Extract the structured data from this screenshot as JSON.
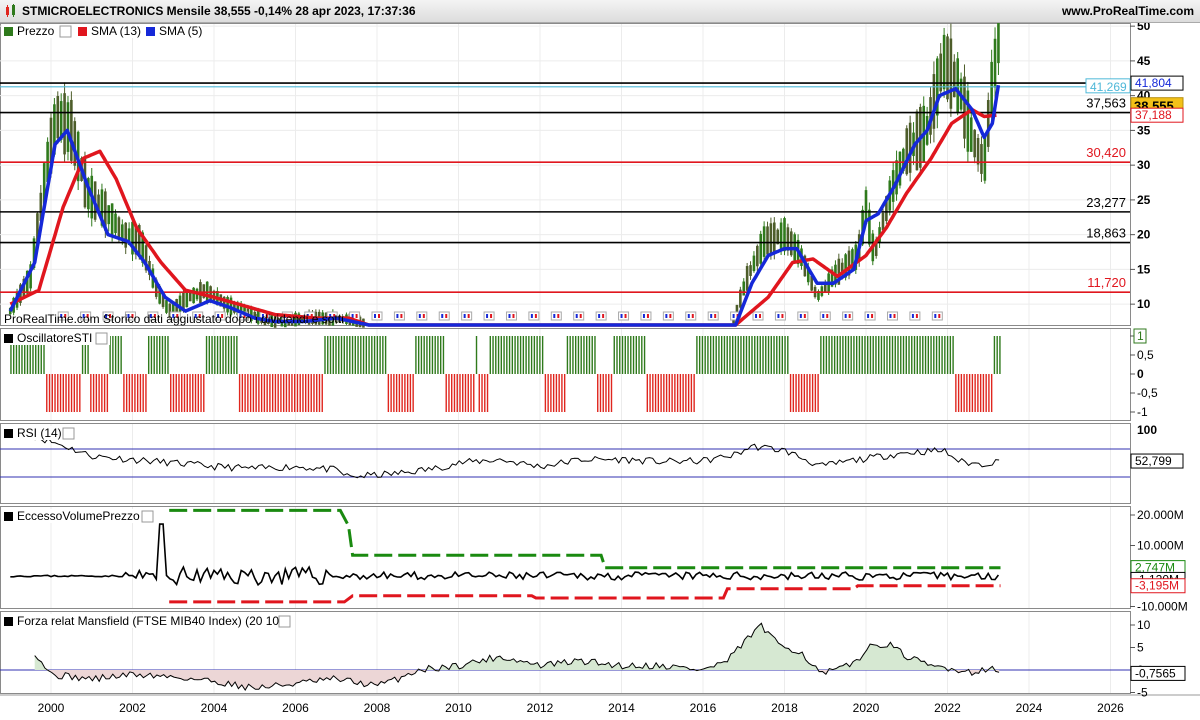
{
  "header": {
    "title": "STMICROELECTRONICS Mensile 38,555 -0,14% 28 apr 2023, 17:37:36",
    "site": "www.ProRealTime.com"
  },
  "watermark": "ProRealTime.com  Storico dati aggiustato dopo i dividendi e sotti",
  "colors": {
    "up": "#2f7a1c",
    "down": "#e0261e",
    "sma13": "#e0161e",
    "sma5": "#1528d8",
    "cyan": "#4fb8d8",
    "vol_upper": "#1a8a10",
    "vol_lower": "#e0161e"
  },
  "chart_data": [
    {
      "panel": "price",
      "type": "bar",
      "legend": [
        {
          "label": "Prezzo",
          "icon": "price-icon"
        },
        {
          "label": "SMA (13)",
          "color": "#e0161e"
        },
        {
          "label": "SMA (5)",
          "color": "#1528d8"
        }
      ],
      "x_ticks": [
        "2000",
        "2002",
        "2004",
        "2006",
        "2008",
        "2010",
        "2012",
        "2014",
        "2016",
        "2018",
        "2020",
        "2022",
        "2024",
        "2026"
      ],
      "y_ticks": [
        "50",
        "45",
        "40",
        "35",
        "30",
        "25",
        "20",
        "15",
        "10"
      ],
      "ylim": [
        7,
        50
      ],
      "levels": [
        {
          "value": 41.804,
          "label": "41,804",
          "color": "#000000",
          "tag": "box"
        },
        {
          "value": 41.269,
          "label": "41,269",
          "color": "#4fb8d8",
          "tag": "box"
        },
        {
          "value": 37.563,
          "label": "37,563",
          "color": "#000000",
          "tag": "text"
        },
        {
          "value": 30.42,
          "label": "30,420",
          "color": "#e0161e",
          "tag": "text"
        },
        {
          "value": 23.277,
          "label": "23,277",
          "color": "#000000",
          "tag": "text"
        },
        {
          "value": 18.863,
          "label": "18,863",
          "color": "#000000",
          "tag": "text"
        },
        {
          "value": 11.72,
          "label": "11,720",
          "color": "#e0161e",
          "tag": "text"
        }
      ],
      "last_price": {
        "value": 38.555,
        "label": "38,555"
      },
      "sma13_last": {
        "value": 37.188,
        "label": "37,188"
      },
      "sma5_anchors": [
        [
          1999.0,
          9
        ],
        [
          1999.6,
          16
        ],
        [
          2000.1,
          33
        ],
        [
          2000.4,
          35
        ],
        [
          2000.9,
          27
        ],
        [
          2001.4,
          20
        ],
        [
          2001.9,
          19
        ],
        [
          2002.3,
          16
        ],
        [
          2002.8,
          11
        ],
        [
          2003.3,
          9
        ],
        [
          2003.9,
          10.5
        ],
        [
          2004.4,
          9.5
        ],
        [
          2005.0,
          8
        ],
        [
          2005.5,
          7.5
        ],
        [
          2006.2,
          7.5
        ],
        [
          2007.0,
          8
        ],
        [
          2007.8,
          7
        ],
        [
          2016.8,
          7
        ],
        [
          2017.2,
          13
        ],
        [
          2017.6,
          17
        ],
        [
          2018.0,
          18
        ],
        [
          2018.3,
          18
        ],
        [
          2018.8,
          13
        ],
        [
          2019.2,
          13
        ],
        [
          2019.7,
          15
        ],
        [
          2020.0,
          22
        ],
        [
          2020.3,
          23
        ],
        [
          2020.7,
          27
        ],
        [
          2021.2,
          33
        ],
        [
          2021.5,
          35
        ],
        [
          2021.8,
          40
        ],
        [
          2022.2,
          41
        ],
        [
          2022.6,
          38
        ],
        [
          2022.9,
          34
        ],
        [
          2023.1,
          36
        ],
        [
          2023.25,
          41.5
        ]
      ],
      "sma13_anchors": [
        [
          1999.0,
          10
        ],
        [
          1999.7,
          12
        ],
        [
          2000.3,
          24
        ],
        [
          2000.8,
          31
        ],
        [
          2001.2,
          32
        ],
        [
          2001.6,
          28
        ],
        [
          2002.1,
          21
        ],
        [
          2002.7,
          16
        ],
        [
          2003.3,
          12
        ],
        [
          2004.0,
          11
        ],
        [
          2004.6,
          10
        ],
        [
          2005.5,
          8.5
        ],
        [
          2006.5,
          8
        ],
        [
          2007.3,
          8
        ],
        [
          2007.8,
          7
        ],
        [
          2016.8,
          7
        ],
        [
          2017.6,
          11
        ],
        [
          2018.2,
          16
        ],
        [
          2018.7,
          16.5
        ],
        [
          2019.3,
          14
        ],
        [
          2020.0,
          17
        ],
        [
          2020.5,
          21
        ],
        [
          2021.0,
          26
        ],
        [
          2021.6,
          31
        ],
        [
          2022.1,
          36
        ],
        [
          2022.6,
          38
        ],
        [
          2022.9,
          37
        ],
        [
          2023.2,
          37.188
        ]
      ],
      "price_anchors": [
        [
          1999.0,
          9
        ],
        [
          1999.5,
          14
        ],
        [
          1999.9,
          30
        ],
        [
          2000.15,
          37
        ],
        [
          2000.5,
          35
        ],
        [
          2000.9,
          26
        ],
        [
          2001.4,
          23
        ],
        [
          2001.8,
          20
        ],
        [
          2002.2,
          19
        ],
        [
          2002.6,
          12
        ],
        [
          2002.9,
          9
        ],
        [
          2003.4,
          11
        ],
        [
          2003.8,
          12
        ],
        [
          2004.3,
          10
        ],
        [
          2004.9,
          8.5
        ],
        [
          2005.5,
          7.5
        ],
        [
          2006.4,
          8
        ],
        [
          2007.4,
          7.8
        ],
        [
          2007.8,
          7
        ],
        [
          2016.7,
          7
        ],
        [
          2017.1,
          14
        ],
        [
          2017.5,
          19
        ],
        [
          2018.0,
          20
        ],
        [
          2018.4,
          17
        ],
        [
          2018.8,
          11
        ],
        [
          2019.2,
          14
        ],
        [
          2019.8,
          17
        ],
        [
          2020.0,
          24
        ],
        [
          2020.2,
          17
        ],
        [
          2020.6,
          26
        ],
        [
          2021.0,
          32
        ],
        [
          2021.5,
          35
        ],
        [
          2021.9,
          45
        ],
        [
          2022.3,
          41
        ],
        [
          2022.6,
          34
        ],
        [
          2022.9,
          30
        ],
        [
          2023.1,
          42
        ],
        [
          2023.25,
          48
        ],
        [
          2023.3,
          38.5
        ]
      ]
    },
    {
      "panel": "oscillator",
      "type": "bar",
      "legend": [
        {
          "label": "OscillatoreSTI"
        }
      ],
      "y_ticks": [
        "1",
        "0,5",
        "0",
        "-0,5",
        "-1"
      ],
      "ylim": [
        -1,
        1
      ],
      "badge": "1",
      "pattern": "GGGGGGGGGGGGGRRRRRRRRRRRRRGGGRRRRRRRGGGGGRRRRRRRRRGGGGGGGGRRRRRRRRRRRRRGGGGGGGGGGGGRRRRRRRRRRRRRRRRRRRRRRRRRRRRRRRGGGGGGGGGGGGGGGGGGGGGGGRRRRRRRRRRGGGGGGGGGGGRRRRRRRRRRRGRRRRGGGGGGGGGGGGGGGGGGGGRRRRRRRRGGGGGGGGGGGRRRRRRGGGGGGGGGGGGRRRRRRRRRRRRRRRRRRGGGGGGGGGGGGGGGGGGGGGGGGGGGGGGGGGGRRRRRRRRRRRGGGGGGGGGGGGGGGGGGGGGGGGGGGGGGGGGGGGGGGGGGGGGGGGGRRRRRRRRRRRRRRGGGGGG"
    },
    {
      "panel": "rsi",
      "type": "line",
      "legend": [
        {
          "label": "RSI (14)"
        }
      ],
      "y_ticks": [
        "100"
      ],
      "bands": [
        70,
        30
      ],
      "ylim": [
        0,
        100
      ],
      "last": {
        "value": 52.799,
        "label": "52,799"
      },
      "anchors": [
        [
          1999.6,
          88
        ],
        [
          2000.3,
          75
        ],
        [
          2001.0,
          60
        ],
        [
          2002.0,
          55
        ],
        [
          2003.0,
          50
        ],
        [
          2004.0,
          45
        ],
        [
          2005.0,
          42
        ],
        [
          2006.0,
          45
        ],
        [
          2007.0,
          40
        ],
        [
          2007.3,
          30
        ],
        [
          2008.5,
          35
        ],
        [
          2009.4,
          42
        ],
        [
          2010.0,
          50
        ],
        [
          2011.0,
          55
        ],
        [
          2012.0,
          45
        ],
        [
          2013.0,
          55
        ],
        [
          2014.0,
          55
        ],
        [
          2015.0,
          52
        ],
        [
          2016.0,
          53
        ],
        [
          2016.8,
          62
        ],
        [
          2017.2,
          74
        ],
        [
          2018.0,
          68
        ],
        [
          2018.9,
          45
        ],
        [
          2019.5,
          52
        ],
        [
          2020.2,
          58
        ],
        [
          2021.0,
          65
        ],
        [
          2021.9,
          68
        ],
        [
          2022.3,
          52
        ],
        [
          2022.8,
          48
        ],
        [
          2023.3,
          52.8
        ]
      ]
    },
    {
      "panel": "volume",
      "type": "line",
      "legend": [
        {
          "label": "EccessoVolumePrezzo"
        }
      ],
      "y_ticks": [
        "20.000M",
        "10.000M",
        "-10.000M"
      ],
      "ylim": [
        -12000,
        22000
      ],
      "levels": [
        {
          "value": 2747,
          "label": "2,747M",
          "color": "#1a8a10",
          "tag": "box"
        },
        {
          "value": -1120,
          "label": "-1,120M",
          "color": "#000000",
          "tag": "box"
        },
        {
          "value": -3195,
          "label": "-3,195M",
          "color": "#e0161e",
          "tag": "box"
        }
      ],
      "upper": [
        [
          2002.9,
          21500
        ],
        [
          2007.1,
          21500
        ],
        [
          2007.3,
          16500
        ],
        [
          2007.4,
          6800
        ],
        [
          2013.5,
          6800
        ],
        [
          2013.6,
          2700
        ],
        [
          2023.3,
          2700
        ]
      ],
      "lower": [
        [
          2002.9,
          -8500
        ],
        [
          2007.2,
          -8500
        ],
        [
          2007.4,
          -6500
        ],
        [
          2011.8,
          -6500
        ],
        [
          2011.9,
          -7200
        ],
        [
          2016.5,
          -7200
        ],
        [
          2016.6,
          -4200
        ],
        [
          2019.7,
          -4200
        ],
        [
          2019.8,
          -3200
        ],
        [
          2023.3,
          -3200
        ]
      ],
      "spike": {
        "x": 2002.7,
        "y": 17000
      },
      "last": -1120
    },
    {
      "panel": "mansfield",
      "type": "area",
      "legend": [
        {
          "label": "Forza relat Mansfield (FTSE MIB40 Index) (20 10)"
        }
      ],
      "y_ticks": [
        "10",
        "5",
        "0",
        "-5"
      ],
      "ylim": [
        -5,
        12
      ],
      "last": {
        "value": -0.7565,
        "label": "-0,7565"
      },
      "anchors": [
        [
          1999.6,
          4
        ],
        [
          2000.0,
          -1
        ],
        [
          2001.0,
          -2
        ],
        [
          2002.0,
          -1
        ],
        [
          2003.0,
          -1.5
        ],
        [
          2004.0,
          -2.5
        ],
        [
          2005.0,
          -4
        ],
        [
          2006.0,
          -3
        ],
        [
          2007.0,
          -2
        ],
        [
          2008.0,
          -3.5
        ],
        [
          2008.5,
          -2
        ],
        [
          2009.0,
          0
        ],
        [
          2010.0,
          1
        ],
        [
          2011.0,
          3
        ],
        [
          2012.0,
          1
        ],
        [
          2013.0,
          2
        ],
        [
          2014.0,
          1
        ],
        [
          2015.0,
          1
        ],
        [
          2016.0,
          0
        ],
        [
          2016.6,
          2
        ],
        [
          2017.1,
          7
        ],
        [
          2017.4,
          10
        ],
        [
          2017.8,
          6
        ],
        [
          2018.4,
          4
        ],
        [
          2018.9,
          -1
        ],
        [
          2019.6,
          1
        ],
        [
          2020.1,
          5
        ],
        [
          2020.5,
          6
        ],
        [
          2021.0,
          3
        ],
        [
          2021.5,
          1
        ],
        [
          2022.0,
          0.5
        ],
        [
          2022.6,
          -0.5
        ],
        [
          2023.0,
          0.5
        ],
        [
          2023.3,
          -0.76
        ]
      ]
    }
  ]
}
